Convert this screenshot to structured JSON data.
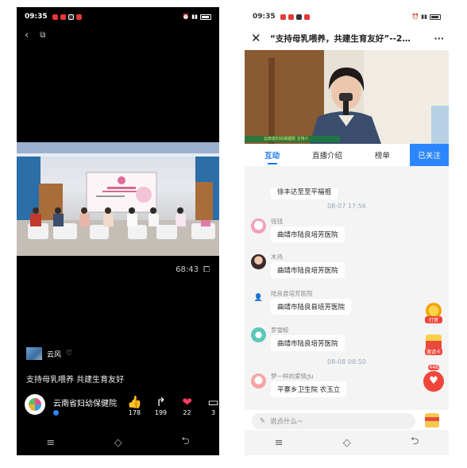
{
  "left": {
    "status": {
      "time": "09:35"
    },
    "video": {
      "duration": "68:43"
    },
    "author": {
      "name": "云风"
    },
    "caption": "支持母乳喂养 共建生育友好",
    "org": {
      "name": "云南省妇幼保健院"
    },
    "actions": {
      "likes": "178",
      "shares": "199",
      "favorites": "22",
      "comments": "3"
    }
  },
  "right": {
    "status": {
      "time": "09:35"
    },
    "title": "“支持母乳喂养，共建生育友好”--2…",
    "video_overlay": "云南省妇幼保健院 主持人",
    "tabs": [
      "互动",
      "直播介绍",
      "榜单",
      "已关注"
    ],
    "chat": {
      "partial": "徐丰达至至平福祖",
      "time1": "08-07 17:56",
      "messages": [
        {
          "user": "钱钱",
          "text": "曲靖市陆良培芳医院"
        },
        {
          "user": "木鸡",
          "text": "曲靖市陆良培芳医院"
        },
        {
          "user": "陆良县培芳医院",
          "text": "曲靖市陆良县培芳医院"
        },
        {
          "user": "罗雪蛟",
          "text": "曲靖市陆良培芳医院"
        },
        {
          "user": "梦一样的爱情ქu",
          "text": "平寨乡卫生院 农玉立"
        }
      ],
      "time2": "08-08 08:50"
    },
    "side": {
      "tip": "打赏",
      "invite": "邀请卡",
      "like_count": "448"
    },
    "input_placeholder": "说点什么~"
  }
}
